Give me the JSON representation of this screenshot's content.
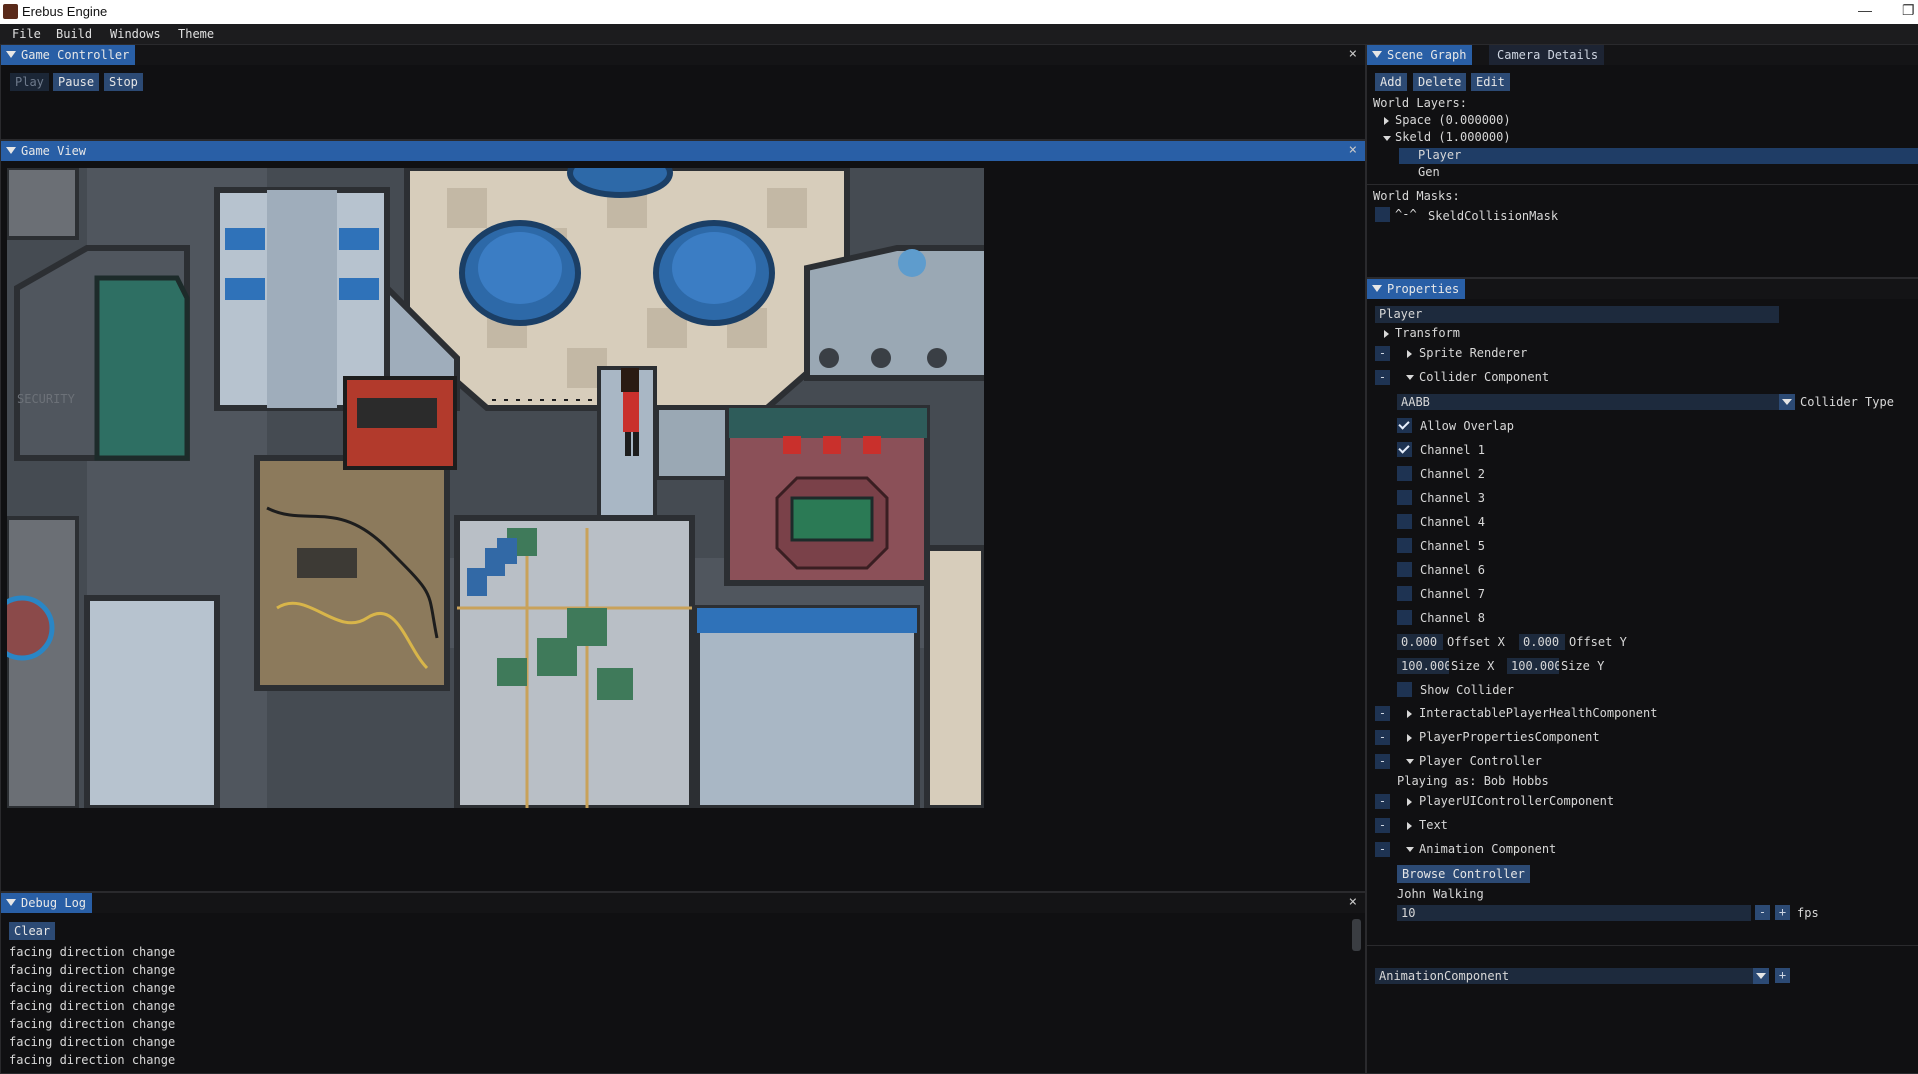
{
  "window": {
    "title": "Erebus Engine",
    "minimize": "—",
    "maximize": "❐"
  },
  "menu": [
    "File",
    "Build",
    "Windows",
    "Theme"
  ],
  "game_controller": {
    "tab": "Game Controller",
    "buttons": {
      "play": "Play",
      "pause": "Pause",
      "stop": "Stop"
    },
    "close": "×"
  },
  "game_view": {
    "tab": "Game View",
    "close": "×"
  },
  "debug_log": {
    "tab": "Debug Log",
    "clear": "Clear",
    "close": "×",
    "lines": [
      "facing direction change",
      "facing direction change",
      "facing direction change",
      "facing direction change",
      "facing direction change",
      "facing direction change",
      "facing direction change"
    ]
  },
  "scene_graph": {
    "tabs": [
      "Scene Graph",
      "Camera Details"
    ],
    "buttons": [
      "Add",
      "Delete",
      "Edit"
    ],
    "world_layers_label": "World Layers:",
    "layers": [
      "Space (0.000000)",
      "Skeld (1.000000)"
    ],
    "skeld_children": [
      "Player",
      "Gen"
    ],
    "world_masks_label": "World Masks:",
    "mask_prefix": "^-^",
    "mask_name": "SkeldCollisionMask"
  },
  "properties": {
    "tab": "Properties",
    "selected": "Player",
    "transform": "Transform",
    "sprite_renderer": "Sprite Renderer",
    "collider_component": "Collider Component",
    "collider_type_value": "AABB",
    "collider_type_label": "Collider Type",
    "allow_overlap": "Allow Overlap",
    "channels": [
      "Channel 1",
      "Channel 2",
      "Channel 3",
      "Channel 4",
      "Channel 5",
      "Channel 6",
      "Channel 7",
      "Channel 8"
    ],
    "channels_checked": [
      true,
      false,
      false,
      false,
      false,
      false,
      false,
      false
    ],
    "offset_x_value": "0.000",
    "offset_x_label": "Offset X",
    "offset_y_value": "0.000",
    "offset_y_label": "Offset Y",
    "size_x_value": "100.000",
    "size_x_label": "Size X",
    "size_y_value": "100.000",
    "size_y_label": "Size Y",
    "show_collider": "Show Collider",
    "interactable": "InteractablePlayerHealthComponent",
    "player_props": "PlayerPropertiesComponent",
    "player_controller": "Player Controller",
    "playing_as": "Playing as: Bob Hobbs",
    "player_ui": "PlayerUIControllerComponent",
    "text": "Text",
    "animation": "Animation Component",
    "browse_controller": "Browse Controller",
    "anim_name": "John Walking",
    "fps_value": "10",
    "fps_label": "fps",
    "minus": "-",
    "plus": "+",
    "add_component_value": "AnimationComponent",
    "add_plus": "+"
  },
  "colors": {
    "accent": "#295fa6",
    "background": "#0d0d0e",
    "button": "#2c4a74"
  }
}
